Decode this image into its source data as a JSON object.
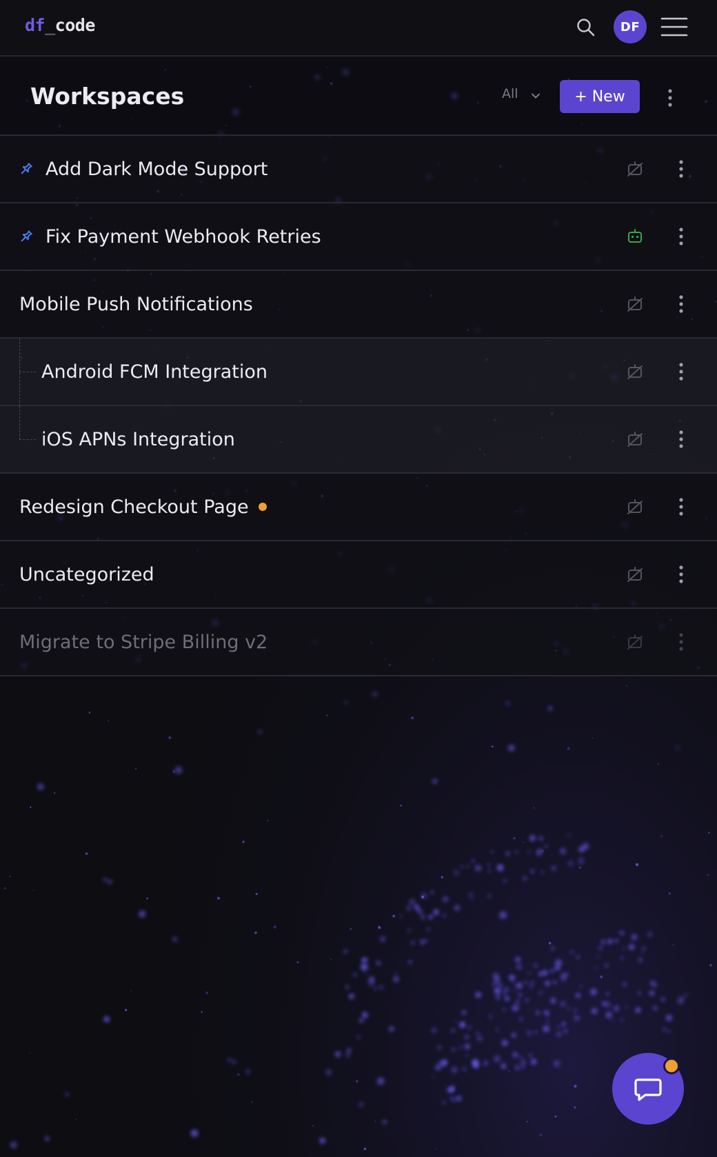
{
  "app": {
    "logo_prefix": "df",
    "logo_sep": "_",
    "logo_suffix": "code"
  },
  "topbar": {
    "avatar_initials": "DF",
    "icons": [
      "search-icon",
      "hamburger-menu-icon"
    ]
  },
  "header": {
    "title": "Workspaces",
    "filter": {
      "selected": "All"
    },
    "new_button": "+ New",
    "more_icon": "vertical-ellipsis-icon"
  },
  "colors": {
    "accent": "#5b45d0",
    "pin": "#4a7cf0",
    "agent_active": "#3aa84a",
    "agent_idle": "#55555e",
    "unsaved_dot": "#f0a030",
    "fab_badge": "#f0a030"
  },
  "workspaces": [
    {
      "label": "Add Dark Mode Support",
      "pinned": true,
      "agent": "idle"
    },
    {
      "label": "Fix Payment Webhook Retries",
      "pinned": true,
      "agent": "active"
    },
    {
      "label": "Mobile Push Notifications",
      "pinned": false,
      "agent": "idle"
    },
    {
      "label": "Android FCM Integration",
      "child": true,
      "agent": "idle"
    },
    {
      "label": "iOS APNs Integration",
      "child": true,
      "agent": "idle"
    },
    {
      "label": "Redesign Checkout Page",
      "pinned": false,
      "agent": "idle",
      "dot": true
    },
    {
      "label": "Uncategorized",
      "pinned": false,
      "agent": "idle"
    },
    {
      "label": "Migrate to Stripe Billing v2",
      "pinned": false,
      "agent": "idle",
      "archived": true
    }
  ],
  "fab": {
    "icon": "chat-icon",
    "has_notification": true
  }
}
